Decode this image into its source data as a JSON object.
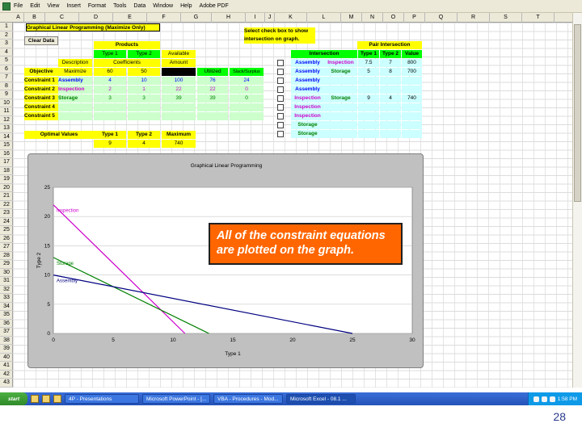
{
  "menu": {
    "items": [
      "File",
      "Edit",
      "View",
      "Insert",
      "Format",
      "Tools",
      "Data",
      "Window",
      "Help",
      "Adobe PDF"
    ]
  },
  "columns": [
    "A",
    "B",
    "C",
    "D",
    "E",
    "F",
    "G",
    "H",
    "I",
    "J",
    "K",
    "L",
    "M",
    "N",
    "O",
    "P",
    "Q",
    "R",
    "S",
    "T"
  ],
  "rows": [
    "1",
    "2",
    "3",
    "4",
    "5",
    "6",
    "7",
    "8",
    "9",
    "10",
    "11",
    "12",
    "13",
    "14",
    "15",
    "16",
    "17",
    "18",
    "19",
    "20",
    "21",
    "22",
    "23",
    "24",
    "25",
    "26",
    "27",
    "28",
    "29",
    "30",
    "31",
    "32",
    "33",
    "34",
    "35",
    "36",
    "37",
    "38",
    "39",
    "40",
    "41",
    "42",
    "43"
  ],
  "sheet": {
    "title": "Graphical Linear Programming (Maximize Only)",
    "clear_button": "Clear Data",
    "select_hint_1": "Select check box to show",
    "select_hint_2": "intersection on graph.",
    "products_label": "Products",
    "type1": "Type 1",
    "type2": "Type 2",
    "available": "Available",
    "description_label": "Description",
    "coefficients_label": "Coefficients",
    "amount_label": "Amount",
    "objective_label": "Objective",
    "maximize_label": "Maximize",
    "obj_c1": "60",
    "obj_c2": "50",
    "utilized_label": "Utilized",
    "slack_label": "Slack/Surplus",
    "constraints": [
      {
        "label": "Constraint 1",
        "name": "Assembly",
        "c1": "4",
        "c2": "10",
        "amount": "100",
        "utilized": "76",
        "slack": "24"
      },
      {
        "label": "Constraint 2",
        "name": "Inspection",
        "c1": "2",
        "c2": "1",
        "amount": "22",
        "utilized": "22",
        "slack": "0"
      },
      {
        "label": "Constraint 3",
        "name": "Storage",
        "c1": "3",
        "c2": "3",
        "amount": "39",
        "utilized": "39",
        "slack": "0"
      },
      {
        "label": "Constraint 4",
        "name": "",
        "c1": "",
        "c2": "",
        "amount": "",
        "utilized": "",
        "slack": ""
      },
      {
        "label": "Constraint 5",
        "name": "",
        "c1": "",
        "c2": "",
        "amount": "",
        "utilized": "",
        "slack": ""
      }
    ],
    "optimal_label": "Optimal Values",
    "maximum_label": "Maximum",
    "opt_t1": "9",
    "opt_t2": "4",
    "opt_max": "740",
    "pair_title": "Pair Intersection",
    "intersection_label": "Intersection",
    "p_type1": "Type 1",
    "p_type2": "Type 2",
    "p_value": "Value",
    "pairs": [
      {
        "a": "Assembly",
        "b": "Inspection",
        "t1": "7.5",
        "t2": "7",
        "v": "800"
      },
      {
        "a": "Assembly",
        "b": "Storage",
        "t1": "5",
        "t2": "8",
        "v": "700"
      },
      {
        "a": "Assembly",
        "b": "",
        "t1": "",
        "t2": "",
        "v": ""
      },
      {
        "a": "Assembly",
        "b": "",
        "t1": "",
        "t2": "",
        "v": ""
      },
      {
        "a": "Inspection",
        "b": "Storage",
        "t1": "9",
        "t2": "4",
        "v": "740"
      },
      {
        "a": "Inspection",
        "b": "",
        "t1": "",
        "t2": "",
        "v": ""
      },
      {
        "a": "Inspection",
        "b": "",
        "t1": "",
        "t2": "",
        "v": ""
      },
      {
        "a": "Storage",
        "b": "",
        "t1": "",
        "t2": "",
        "v": ""
      },
      {
        "a": "Storage",
        "b": "",
        "t1": "",
        "t2": "",
        "v": ""
      }
    ]
  },
  "chart_data": {
    "type": "line",
    "title": "Graphical Linear Programming",
    "xlabel": "Type 1",
    "ylabel": "Type 2",
    "xlim": [
      0,
      30
    ],
    "ylim": [
      0,
      25
    ],
    "xticks": [
      "0",
      "5",
      "10",
      "15",
      "20",
      "25",
      "30"
    ],
    "yticks": [
      "0",
      "5",
      "10",
      "15",
      "20",
      "25"
    ],
    "series": [
      {
        "name": "Inspection",
        "color": "#cc00cc",
        "points": [
          [
            0,
            22
          ],
          [
            11,
            0
          ]
        ]
      },
      {
        "name": "Storage",
        "color": "#008000",
        "points": [
          [
            0,
            13
          ],
          [
            13,
            0
          ]
        ]
      },
      {
        "name": "Assembly",
        "color": "#000080",
        "points": [
          [
            0,
            10
          ],
          [
            25,
            0
          ]
        ]
      }
    ]
  },
  "callout": {
    "text": "All of the constraint equations are plotted on the graph."
  },
  "taskbar": {
    "start": "start",
    "tasks": [
      "4P - Presentations",
      "Microsoft PowerPoint - [...",
      "VBA - Procedures - Mod...",
      "Microsoft Excel - 08.1 ..."
    ],
    "clock": "1:58 PM"
  },
  "page_number": "28",
  "colors": {
    "yellow": "#ffff00",
    "green": "#00ff00",
    "cyan": "#ccffff",
    "callout": "#ff6600",
    "page_number": "#2a3a8c"
  }
}
